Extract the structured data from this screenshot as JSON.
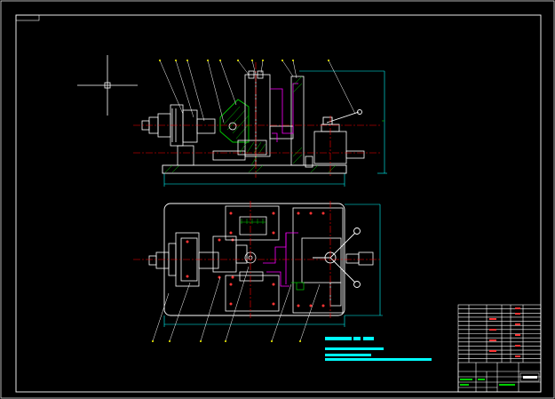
{
  "drawing": {
    "background": "#000000",
    "colors": {
      "frame": "#ffffff",
      "part_outline": "#ffffff",
      "hatch": "#00cc00",
      "dimension": "#00ffff",
      "centerline": "#ff0000",
      "workpiece": "#ff00ff",
      "leader": "#ffff00",
      "bolt_holes": "#ff3333"
    },
    "title_block": {
      "name_text": "",
      "rows": 14
    },
    "notes": {
      "line_count": 4
    },
    "views": [
      "front-elevation",
      "top-plan"
    ]
  }
}
